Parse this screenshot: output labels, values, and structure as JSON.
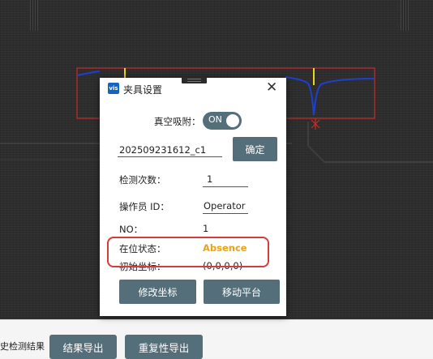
{
  "dialog": {
    "app_icon_text": "vis",
    "title": "夹具设置",
    "close_glyph": "✕",
    "vacuum_label": "真空吸附：",
    "vacuum_toggle": "ON",
    "batch_value": "20250923161​2_c1",
    "confirm_label": "确定",
    "detect_count_label": "检测次数：",
    "detect_count_value": "1",
    "operator_label": "操作员 ID：",
    "operator_value": "Operator",
    "no_label": "NO：",
    "no_value": "1",
    "presence_label": "在位状态：",
    "presence_value": "Absence",
    "origin_label": "初始坐标：",
    "origin_value": "(0,0,0,0)",
    "modify_coord_label": "修改坐标",
    "move_platform_label": "移动平台"
  },
  "toolbar": {
    "history_label": "史检测结果",
    "export_results_label": "结果导出",
    "export_repeat_label": "重复性导出"
  },
  "colors": {
    "accent": "#546e7a",
    "status_warning": "#e8a317",
    "highlight_box": "#d63a3a",
    "profile_line": "#1e3fd0",
    "marker": "#e6d81c"
  },
  "icons": [
    "vis-app-icon",
    "close-icon",
    "toggle-switch",
    "drag-grip-icon"
  ]
}
